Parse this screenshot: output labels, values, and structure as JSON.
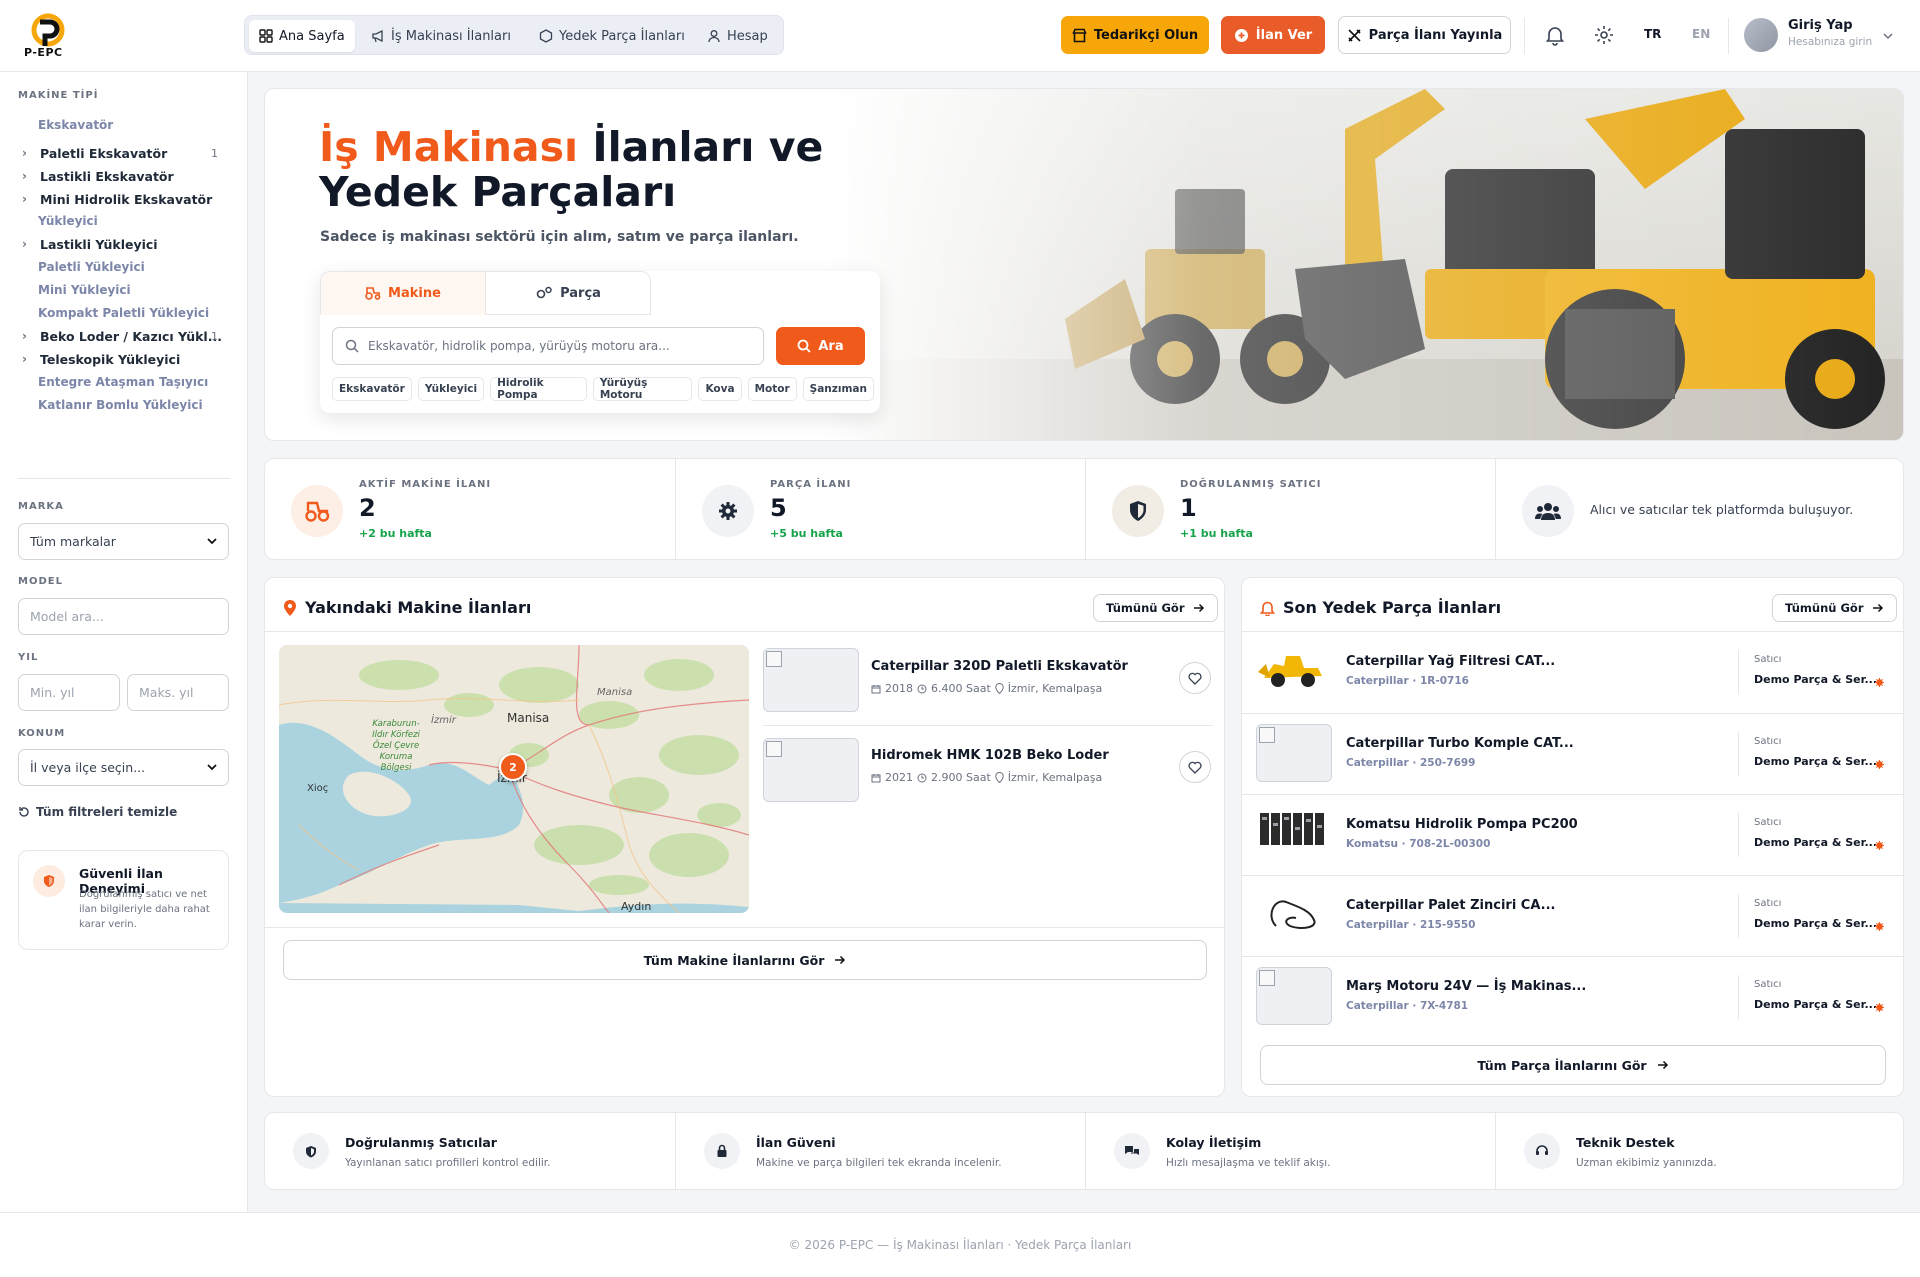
{
  "brand": {
    "name": "P-EPC",
    "accent": "#f05a1a",
    "yellow": "#f6a609"
  },
  "nav": {
    "items": [
      {
        "label": "Ana Sayfa",
        "icon": "grid-icon",
        "active": true
      },
      {
        "label": "İş Makinası İlanları",
        "icon": "megaphone-icon",
        "active": false
      },
      {
        "label": "Yedek Parça İlanları",
        "icon": "hexagon-icon",
        "active": false
      },
      {
        "label": "Hesap",
        "icon": "user-icon",
        "active": false
      }
    ],
    "supplier_button": "Tedarikçi Olun",
    "post_ad_button": "İlan Ver",
    "post_part_button": "Parça İlanı Yayınla",
    "lang_tr": "TR",
    "lang_en": "EN",
    "login_title": "Giriş Yap",
    "login_sub": "Hesabınıza girin"
  },
  "sidebar": {
    "machine_type_heading": "MAKİNE TİPİ",
    "categories": [
      {
        "label": "Ekskavatör",
        "kind": "sub",
        "count": ""
      },
      {
        "label": "Paletli Ekskavatör",
        "kind": "cat",
        "count": "1"
      },
      {
        "label": "Lastikli Ekskavatör",
        "kind": "cat",
        "count": ""
      },
      {
        "label": "Mini Hidrolik Ekskavatör",
        "kind": "cat",
        "count": ""
      },
      {
        "label": "Yükleyici",
        "kind": "sub",
        "count": ""
      },
      {
        "label": "Lastikli Yükleyici",
        "kind": "cat",
        "count": ""
      },
      {
        "label": "Paletli Yükleyici",
        "kind": "sub",
        "count": ""
      },
      {
        "label": "Mini Yükleyici",
        "kind": "sub",
        "count": ""
      },
      {
        "label": "Kompakt Paletli Yükleyici",
        "kind": "sub",
        "count": ""
      },
      {
        "label": "Beko Loder / Kazıcı Yükl...",
        "kind": "cat",
        "count": "1"
      },
      {
        "label": "Teleskopik Yükleyici",
        "kind": "cat",
        "count": ""
      },
      {
        "label": "Entegre Ataşman Taşıyıcı",
        "kind": "sub",
        "count": ""
      },
      {
        "label": "Katlanır Bomlu Yükleyici",
        "kind": "sub",
        "count": ""
      }
    ],
    "brand_heading": "MARKA",
    "brand_value": "Tüm markalar",
    "model_heading": "MODEL",
    "model_placeholder": "Model ara...",
    "year_heading": "YIL",
    "year_min_placeholder": "Min. yıl",
    "year_max_placeholder": "Maks. yıl",
    "location_heading": "KONUM",
    "location_value": "İl veya ilçe seçin...",
    "clear_filters": "Tüm filtreleri temizle",
    "safe_title": "Güvenli İlan Deneyimi",
    "safe_text": "Doğrulanmış satıcı ve net ilan bilgileriyle daha rahat karar verin."
  },
  "hero": {
    "title_highlight": "İş Makinası",
    "title_rest1": " İlanları ve",
    "title_line2": "Yedek Parçaları",
    "subtitle": "Sadece iş makinası sektörü için alım, satım ve parça ilanları.",
    "tab_machine": "Makine",
    "tab_part": "Parça",
    "search_placeholder": "Ekskavatör, hidrolik pompa, yürüyüş motoru ara...",
    "search_button": "Ara",
    "chips": [
      "Ekskavatör",
      "Yükleyici",
      "Hidrolik Pompa",
      "Yürüyüş Motoru",
      "Kova",
      "Motor",
      "Şanzıman"
    ]
  },
  "stats": [
    {
      "label": "AKTİF MAKİNE İLANI",
      "value": "2",
      "change": "+2 bu hafta",
      "icon": "tractor-icon"
    },
    {
      "label": "PARÇA İLANI",
      "value": "5",
      "change": "+5 bu hafta",
      "icon": "gear-icon"
    },
    {
      "label": "DOĞRULANMIŞ SATICI",
      "value": "1",
      "change": "+1 bu hafta",
      "icon": "shield-icon"
    },
    {
      "text": "Alıcı ve satıcılar tek platformda buluşuyor.",
      "icon": "users-icon"
    }
  ],
  "machines_panel": {
    "title": "Yakındaki Makine İlanları",
    "see_all": "Tümünü Gör",
    "map_labels": [
      "Manisa",
      "Manisa",
      "İzmir",
      "İzmir",
      "Karaburun-Ildır Körfezi Özel Çevre Koruma Bölgesi",
      "Aydın",
      "Xioç"
    ],
    "map_cluster_count": "2",
    "listings": [
      {
        "title": "Caterpillar 320D Paletli Ekskavatör",
        "year": "2018",
        "hours": "6.400 Saat",
        "location": "İzmir, Kemalpaşa"
      },
      {
        "title": "Hidromek HMK 102B Beko Loder",
        "year": "2021",
        "hours": "2.900 Saat",
        "location": "İzmir, Kemalpaşa"
      }
    ],
    "all_button": "Tüm Makine İlanlarını Gör"
  },
  "parts_panel": {
    "title": "Son Yedek Parça İlanları",
    "see_all": "Tümünü Gör",
    "seller_label": "Satıcı",
    "parts": [
      {
        "title": "Caterpillar Yağ Filtresi CAT...",
        "meta": "Caterpillar · 1R-0716",
        "seller": "Demo Parça & Ser...",
        "thumb": "loader"
      },
      {
        "title": "Caterpillar Turbo Komple CAT...",
        "meta": "Caterpillar · 250-7699",
        "seller": "Demo Parça & Ser...",
        "thumb": "broken"
      },
      {
        "title": "Komatsu Hidrolik Pompa PC200",
        "meta": "Komatsu · 708-2L-00300",
        "seller": "Demo Parça & Ser...",
        "thumb": "pumps"
      },
      {
        "title": "Caterpillar Palet Zinciri CA...",
        "meta": "Caterpillar · 215-9550",
        "seller": "Demo Parça & Ser...",
        "thumb": "chain"
      },
      {
        "title": "Marş Motoru 24V — İş Makinas...",
        "meta": "Caterpillar · 7X-4781",
        "seller": "Demo Parça & Ser...",
        "thumb": "broken"
      }
    ],
    "all_button": "Tüm Parça İlanlarını Gör"
  },
  "features": [
    {
      "title": "Doğrulanmış Satıcılar",
      "desc": "Yayınlanan satıcı profilleri kontrol edilir.",
      "icon": "shield-icon"
    },
    {
      "title": "İlan Güveni",
      "desc": "Makine ve parça bilgileri tek ekranda incelenir.",
      "icon": "lock-icon"
    },
    {
      "title": "Kolay İletişim",
      "desc": "Hızlı mesajlaşma ve teklif akışı.",
      "icon": "chat-icon"
    },
    {
      "title": "Teknik Destek",
      "desc": "Uzman ekibimiz yanınızda.",
      "icon": "headset-icon"
    }
  ],
  "footer": "© 2026 P-EPC — İş Makinası İlanları · Yedek Parça İlanları"
}
